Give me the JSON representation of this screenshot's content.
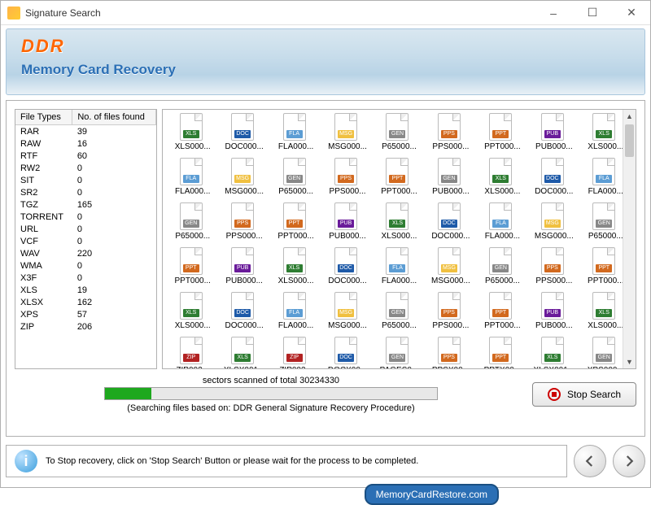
{
  "window": {
    "title": "Signature Search",
    "minimize": "–",
    "maximize": "☐",
    "close": "✕"
  },
  "banner": {
    "brand": "DDR",
    "subtitle": "Memory Card Recovery"
  },
  "table": {
    "col1": "File Types",
    "col2": "No. of files found",
    "rows": [
      {
        "type": "RAR",
        "count": "39"
      },
      {
        "type": "RAW",
        "count": "16"
      },
      {
        "type": "RTF",
        "count": "60"
      },
      {
        "type": "RW2",
        "count": "0"
      },
      {
        "type": "SIT",
        "count": "0"
      },
      {
        "type": "SR2",
        "count": "0"
      },
      {
        "type": "TGZ",
        "count": "165"
      },
      {
        "type": "TORRENT",
        "count": "0"
      },
      {
        "type": "URL",
        "count": "0"
      },
      {
        "type": "VCF",
        "count": "0"
      },
      {
        "type": "WAV",
        "count": "220"
      },
      {
        "type": "WMA",
        "count": "0"
      },
      {
        "type": "X3F",
        "count": "0"
      },
      {
        "type": "XLS",
        "count": "19"
      },
      {
        "type": "XLSX",
        "count": "162"
      },
      {
        "type": "XPS",
        "count": "57"
      },
      {
        "type": "ZIP",
        "count": "206"
      }
    ]
  },
  "files": {
    "rows": [
      [
        {
          "l": "XLS000...",
          "k": "xls"
        },
        {
          "l": "DOC000...",
          "k": "doc"
        },
        {
          "l": "FLA000...",
          "k": "fla"
        },
        {
          "l": "MSG000...",
          "k": "msg"
        },
        {
          "l": "P65000...",
          "k": "gen"
        },
        {
          "l": "PPS000...",
          "k": "pps"
        },
        {
          "l": "PPT000...",
          "k": "ppt"
        },
        {
          "l": "PUB000...",
          "k": "pub"
        },
        {
          "l": "XLS000...",
          "k": "xls"
        }
      ],
      [
        {
          "l": "FLA000...",
          "k": "fla"
        },
        {
          "l": "MSG000...",
          "k": "msg"
        },
        {
          "l": "P65000...",
          "k": "gen"
        },
        {
          "l": "PPS000...",
          "k": "pps"
        },
        {
          "l": "PPT000...",
          "k": "ppt"
        },
        {
          "l": "PUB000...",
          "k": "gen"
        },
        {
          "l": "XLS000...",
          "k": "xls"
        },
        {
          "l": "DOC000...",
          "k": "doc"
        },
        {
          "l": "FLA000...",
          "k": "fla"
        }
      ],
      [
        {
          "l": "P65000...",
          "k": "gen"
        },
        {
          "l": "PPS000...",
          "k": "pps"
        },
        {
          "l": "PPT000...",
          "k": "ppt"
        },
        {
          "l": "PUB000...",
          "k": "pub"
        },
        {
          "l": "XLS000...",
          "k": "xls"
        },
        {
          "l": "DOC000...",
          "k": "doc"
        },
        {
          "l": "FLA000...",
          "k": "fla"
        },
        {
          "l": "MSG000...",
          "k": "msg"
        },
        {
          "l": "P65000...",
          "k": "gen"
        }
      ],
      [
        {
          "l": "PPT000...",
          "k": "ppt"
        },
        {
          "l": "PUB000...",
          "k": "pub"
        },
        {
          "l": "XLS000...",
          "k": "xls"
        },
        {
          "l": "DOC000...",
          "k": "doc"
        },
        {
          "l": "FLA000...",
          "k": "fla"
        },
        {
          "l": "MSG000...",
          "k": "msg"
        },
        {
          "l": "P65000...",
          "k": "gen"
        },
        {
          "l": "PPS000...",
          "k": "pps"
        },
        {
          "l": "PPT000...",
          "k": "ppt"
        }
      ],
      [
        {
          "l": "XLS000...",
          "k": "xls"
        },
        {
          "l": "DOC000...",
          "k": "doc"
        },
        {
          "l": "FLA000...",
          "k": "fla"
        },
        {
          "l": "MSG000...",
          "k": "msg"
        },
        {
          "l": "P65000...",
          "k": "gen"
        },
        {
          "l": "PPS000...",
          "k": "pps"
        },
        {
          "l": "PPT000...",
          "k": "ppt"
        },
        {
          "l": "PUB000...",
          "k": "pub"
        },
        {
          "l": "XLS000...",
          "k": "xls"
        }
      ],
      [
        {
          "l": "ZIP002...",
          "k": "zip"
        },
        {
          "l": "XLSX001...",
          "k": "xls"
        },
        {
          "l": "ZIP002...",
          "k": "zip"
        },
        {
          "l": "DOCX00...",
          "k": "doc"
        },
        {
          "l": "PAGES0...",
          "k": "gen"
        },
        {
          "l": "PPSX00...",
          "k": "pps"
        },
        {
          "l": "PPTX00...",
          "k": "ppt"
        },
        {
          "l": "XLSX001...",
          "k": "xls"
        },
        {
          "l": "XPS000...",
          "k": "gen"
        }
      ]
    ]
  },
  "progress": {
    "text": "sectors scanned of total 30234330",
    "note": "(Searching files based on:  DDR General Signature Recovery Procedure)",
    "stop_label": "Stop Search"
  },
  "hint": {
    "text": "To Stop recovery, click on 'Stop Search' Button or please wait for the process to be completed."
  },
  "site": "MemoryCardRestore.com"
}
